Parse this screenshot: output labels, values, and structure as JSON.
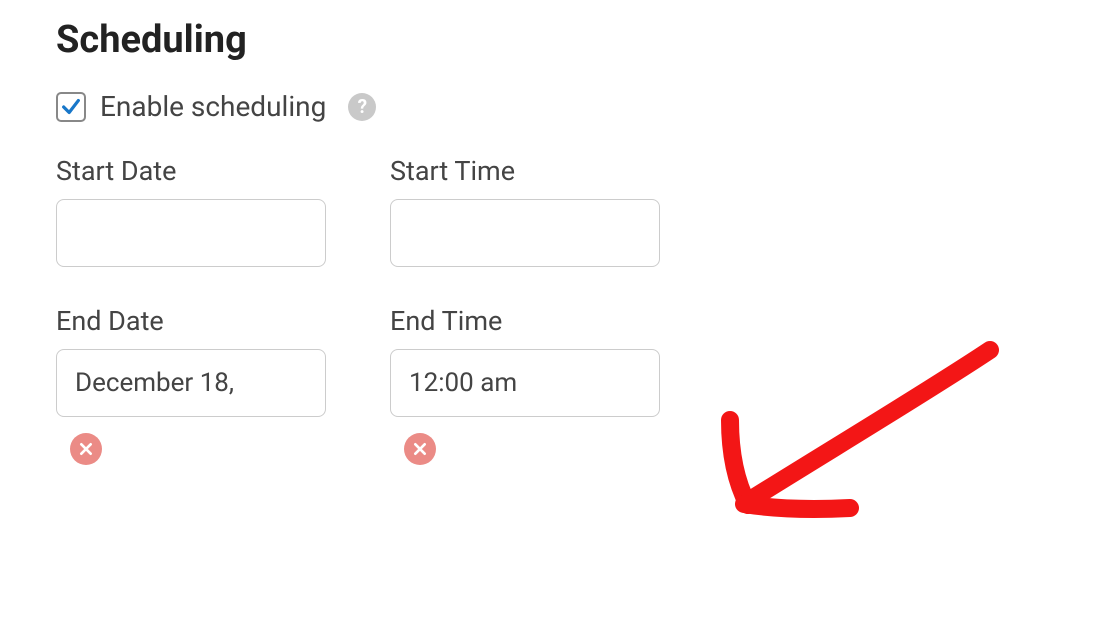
{
  "heading": "Scheduling",
  "enable": {
    "label": "Enable scheduling",
    "checked": true
  },
  "fields": {
    "start_date": {
      "label": "Start Date",
      "value": ""
    },
    "start_time": {
      "label": "Start Time",
      "value": ""
    },
    "end_date": {
      "label": "End Date",
      "value": "December 18,"
    },
    "end_time": {
      "label": "End Time",
      "value": "12:00 am"
    }
  },
  "annotation": {
    "color": "#f31616"
  }
}
